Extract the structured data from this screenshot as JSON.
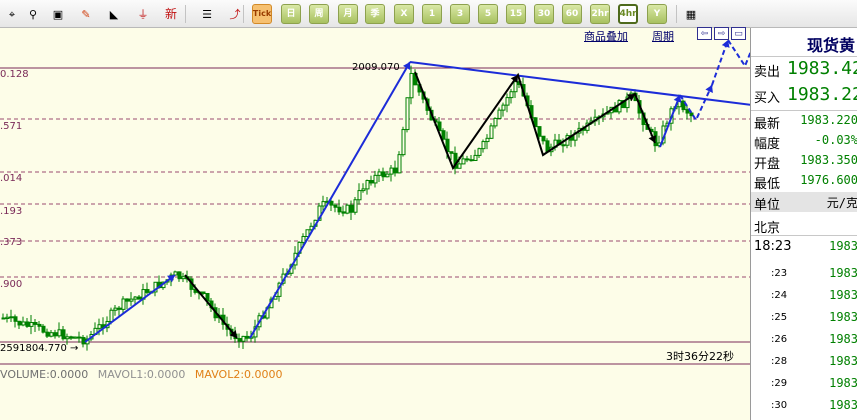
{
  "toolbar": {
    "buttons": [
      {
        "id": "mouse",
        "glyph": "⌖"
      },
      {
        "id": "zoom",
        "glyph": "⚲"
      },
      {
        "id": "window",
        "glyph": "▣"
      },
      {
        "id": "pen",
        "glyph": "✎"
      },
      {
        "id": "shape",
        "glyph": "◣"
      },
      {
        "id": "filter",
        "glyph": "⏚"
      },
      {
        "id": "new",
        "label": "新"
      },
      {
        "id": "list",
        "glyph": "☰"
      },
      {
        "id": "trend",
        "glyph": "⤴"
      },
      {
        "id": "tick",
        "label": "Tick"
      },
      {
        "id": "day",
        "label": "日"
      },
      {
        "id": "week",
        "label": "周"
      },
      {
        "id": "month",
        "label": "月"
      },
      {
        "id": "season",
        "label": "季"
      },
      {
        "id": "year",
        "label": "X"
      },
      {
        "id": "m1",
        "label": "1"
      },
      {
        "id": "m3",
        "label": "3"
      },
      {
        "id": "m5",
        "label": "5"
      },
      {
        "id": "m15",
        "label": "15"
      },
      {
        "id": "m30",
        "label": "30"
      },
      {
        "id": "m60",
        "label": "60"
      },
      {
        "id": "h2",
        "label": "2hr"
      },
      {
        "id": "h4",
        "label": "4hr"
      },
      {
        "id": "yr",
        "label": "Y"
      },
      {
        "id": "grid",
        "glyph": "▦"
      }
    ],
    "selected": "h4"
  },
  "links": {
    "overlay": "商品叠加",
    "period": "周期"
  },
  "price_levels": [
    {
      "label": "0.128",
      "kind": "solid"
    },
    {
      "label": ".571",
      "kind": "dash"
    },
    {
      "label": ".014",
      "kind": "dash"
    },
    {
      "label": ".193",
      "kind": "dash"
    },
    {
      "label": ".373",
      "kind": "dash"
    },
    {
      "label": ".900",
      "kind": "dash"
    },
    {
      "label": "259",
      "kind": "solid"
    }
  ],
  "annotations": {
    "high": "2009.070",
    "low": "1804.770",
    "countdown": "3时36分22秒"
  },
  "volume_legend": {
    "volume": "VOLUME:0.0000",
    "mavol1": "MAVOL1:0.0000",
    "mavol2": "MAVOL2:0.0000"
  },
  "quote": {
    "title": "现货黄",
    "sell_label": "卖出",
    "sell_value": "1983.42",
    "buy_label": "买入",
    "buy_value": "1983.22",
    "latest_label": "最新",
    "latest_value": "1983.220",
    "change_label": "幅度",
    "change_value": "-0.03%",
    "open_label": "开盘",
    "open_value": "1983.350",
    "low_label": "最低",
    "low_value": "1976.600",
    "unit_label": "单位",
    "unit_value": "元/克",
    "location": "北京",
    "time": "18:23",
    "time_price": "1983",
    "ticks": [
      {
        "time": ":23",
        "price": "1983"
      },
      {
        "time": ":24",
        "price": "1983"
      },
      {
        "time": ":25",
        "price": "1983"
      },
      {
        "time": ":26",
        "price": "1983"
      },
      {
        "time": ":28",
        "price": "1983"
      },
      {
        "time": ":29",
        "price": "1983"
      },
      {
        "time": ":30",
        "price": "1983"
      }
    ]
  },
  "colors": {
    "up": "#008000",
    "down": "#008000",
    "trend_blue": "#1c2cd8",
    "wave_black": "#000000",
    "level_solid": "#7a2a58",
    "level_dash": "#9a4a70"
  }
}
